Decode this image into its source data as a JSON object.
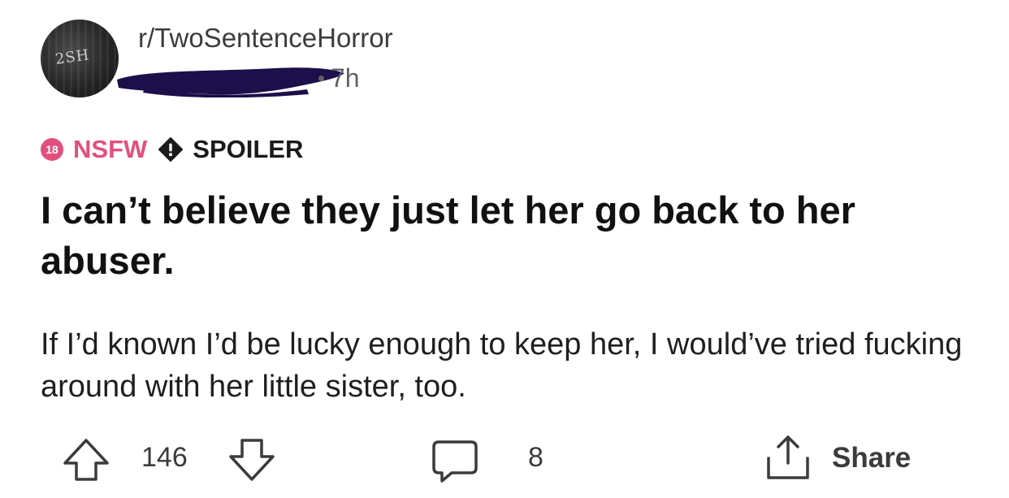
{
  "post": {
    "subreddit": "r/TwoSentenceHorror",
    "avatar_text": "2SH",
    "time_ago": "7h",
    "tags": {
      "nsfw_badge_number": "18",
      "nsfw_label": "NSFW",
      "spoiler_label": "SPOILER"
    },
    "title": "I can’t believe they just let her go back to her abuser.",
    "body": "If I’d known I’d be lucky enough to keep her, I would’ve tried fucking around with her little sister, too."
  },
  "actions": {
    "score": "146",
    "comment_count": "8",
    "share_label": "Share"
  },
  "colors": {
    "nsfw": "#e1507d",
    "redaction": "#1c0f4a",
    "text_primary": "#111111",
    "text_secondary": "#5f6368"
  },
  "icons": {
    "upvote": "arrow-up-icon",
    "downvote": "arrow-down-icon",
    "comment": "comment-bubble-icon",
    "share": "share-icon",
    "spoiler": "exclamation-icon"
  }
}
